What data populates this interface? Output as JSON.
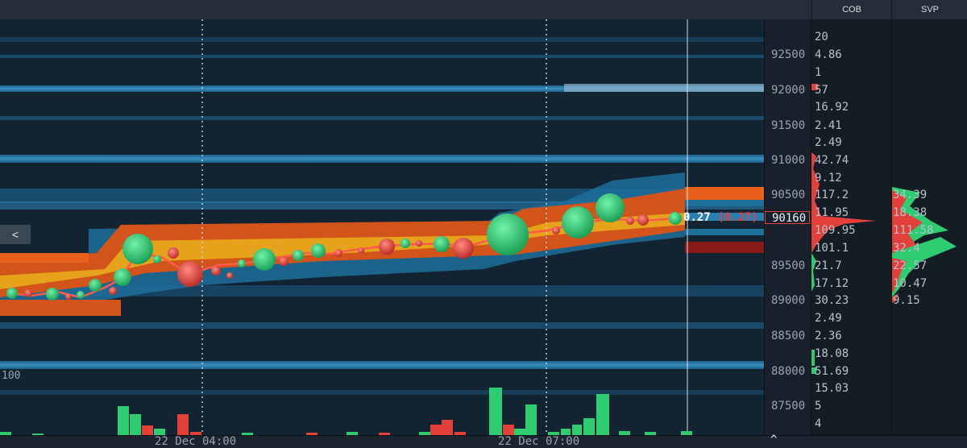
{
  "header": {
    "cob_label": "COB",
    "svp_label": "SVP"
  },
  "price_axis": [
    "92500",
    "92000",
    "91500",
    "91000",
    "90500",
    "90160",
    "89500",
    "89000",
    "88500",
    "88000",
    "87500"
  ],
  "current_price": "90160",
  "cob_values": [
    "20",
    "4.86",
    "1",
    "57",
    "16.92",
    "2.41",
    "2.49",
    "42.74",
    "9.12",
    "117.2",
    "11.95",
    "109.95",
    "101.1",
    "21.7",
    "17.12",
    "30.23",
    "2.49",
    "2.36",
    "18.08",
    "51.69",
    "15.03",
    "5",
    "4"
  ],
  "svp_values": [
    "34.39",
    "18.38",
    "111.58",
    "32.4",
    "22.57",
    "10.47",
    "9.15"
  ],
  "time_axis": [
    "22 Dec 04:00",
    "22 Dec 07:00"
  ],
  "last_trade": {
    "size": "0.27",
    "paren": "(0.27)"
  },
  "volume_label": "100",
  "scroll_button": "<",
  "expand_icon": "^",
  "colors": {
    "background": "#141d26",
    "buy": "#2ecc71",
    "sell": "#e3403a",
    "liquidity_low": "#1f6f99",
    "liquidity_high": "#e8601c",
    "liquidity_max": "#f2c11d"
  }
}
